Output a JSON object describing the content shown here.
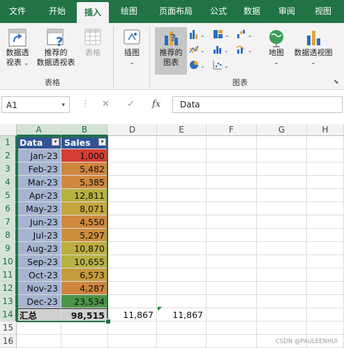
{
  "tabs": [
    "文件",
    "开始",
    "插入",
    "绘图",
    "页面布局",
    "公式",
    "数据",
    "审阅",
    "视图"
  ],
  "active_tab": "插入",
  "ribbon": {
    "pivot_table_l1": "数据透",
    "pivot_table_l2": "视表",
    "rec_pivot_l1": "推荐的",
    "rec_pivot_l2": "数据透视表",
    "table": "表格",
    "group_tables": "表格",
    "illustrations": "插图",
    "rec_charts_l1": "推荐的",
    "rec_charts_l2": "图表",
    "maps": "地图",
    "pivot_chart": "数据透视图",
    "group_charts": "图表"
  },
  "formula_bar": {
    "name_box": "A1",
    "cancel": "✕",
    "enter": "✓",
    "fx": "fx",
    "formula": "Data"
  },
  "columns": [
    "A",
    "B",
    "D",
    "E",
    "F",
    "G",
    "H"
  ],
  "rows": [
    "1",
    "2",
    "3",
    "4",
    "5",
    "6",
    "7",
    "8",
    "9",
    "10",
    "11",
    "12",
    "13",
    "14",
    "15",
    "16"
  ],
  "table": {
    "header_data": "Data",
    "header_sales": "Sales",
    "filter_icon_a": "⯆",
    "filter_icon_b": "⯆",
    "dates": [
      "Jan-23",
      "Feb-23",
      "Mar-23",
      "Apr-23",
      "May-23",
      "Jun-23",
      "Jul-23",
      "Aug-23",
      "Sep-23",
      "Oct-23",
      "Nov-23",
      "Dec-23"
    ],
    "sales": [
      "1,000",
      "5,482",
      "5,385",
      "12,811",
      "8,071",
      "4,550",
      "5,297",
      "10,870",
      "10,655",
      "6,573",
      "4,287",
      "23,534"
    ],
    "sales_colors": [
      "#d63d34",
      "#d0863e",
      "#d0883d",
      "#b7b041",
      "#c4a63e",
      "#d0883d",
      "#cd8e3c",
      "#bdad41",
      "#b8b245",
      "#c69b3d",
      "#cf853e",
      "#4a9547"
    ],
    "total_label": "汇总",
    "total_value": "98,515",
    "d14": "11,867",
    "e14": "11,867"
  },
  "colors": {
    "excel_green": "#217346",
    "table_header": "#305496",
    "date_fill": "#a6b4d0"
  },
  "watermark": "CSDN @PAULEENHUI"
}
